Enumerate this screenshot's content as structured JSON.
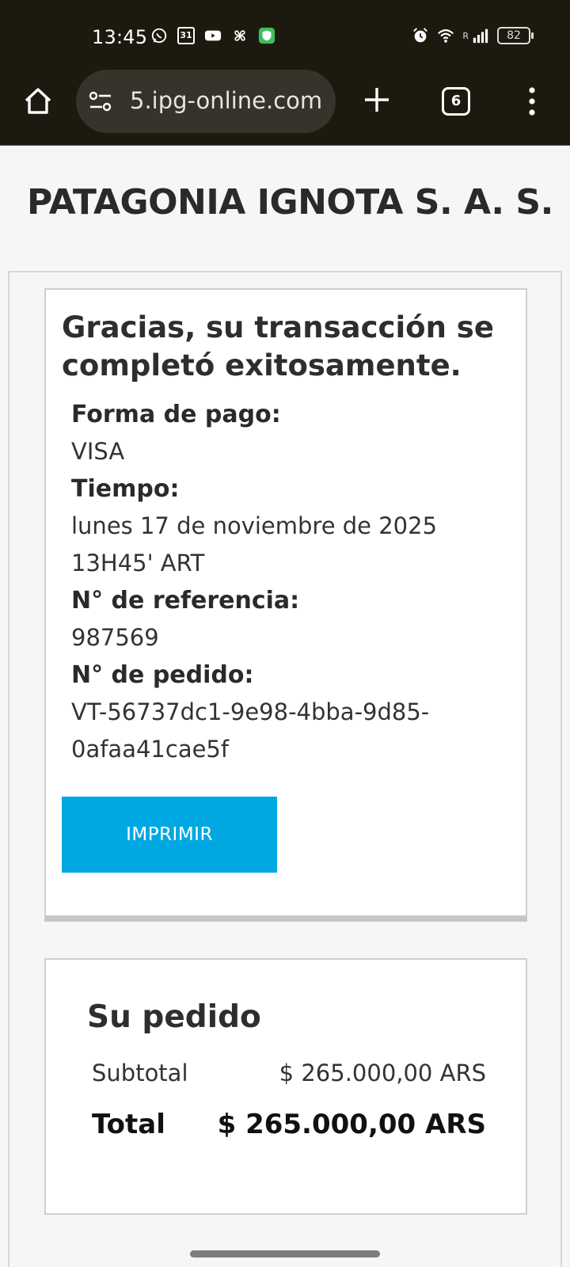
{
  "status_bar": {
    "time": "13:45",
    "calendar_day": "31",
    "network_label": "R",
    "battery": "82"
  },
  "browser": {
    "url_faded": "",
    "url_main": "5.ipg-online.com",
    "tab_count": "6"
  },
  "page": {
    "merchant": "PATAGONIA IGNOTA S. A. S.",
    "confirmation": {
      "title": "Gracias, su transacción se completó exitosamente.",
      "fields": [
        {
          "label": "Forma de pago:",
          "value": "VISA"
        },
        {
          "label": "Tiempo:",
          "value": "lunes 17 de noviembre de 2025\n13H45' ART"
        },
        {
          "label": "N° de referencia:",
          "value": "987569"
        },
        {
          "label": "N° de pedido:",
          "value": "VT-56737dc1-9e98-4bba-9d85-\n0afaa41cae5f"
        }
      ],
      "print_button": "IMPRIMIR"
    },
    "order": {
      "title": "Su pedido",
      "subtotal_label": "Subtotal",
      "subtotal_value": "$ 265.000,00 ARS",
      "total_label": "Total",
      "total_value": "$ 265.000,00 ARS"
    }
  },
  "colors": {
    "button": "#00a8e1",
    "chrome_bg": "#1c1a0e"
  }
}
